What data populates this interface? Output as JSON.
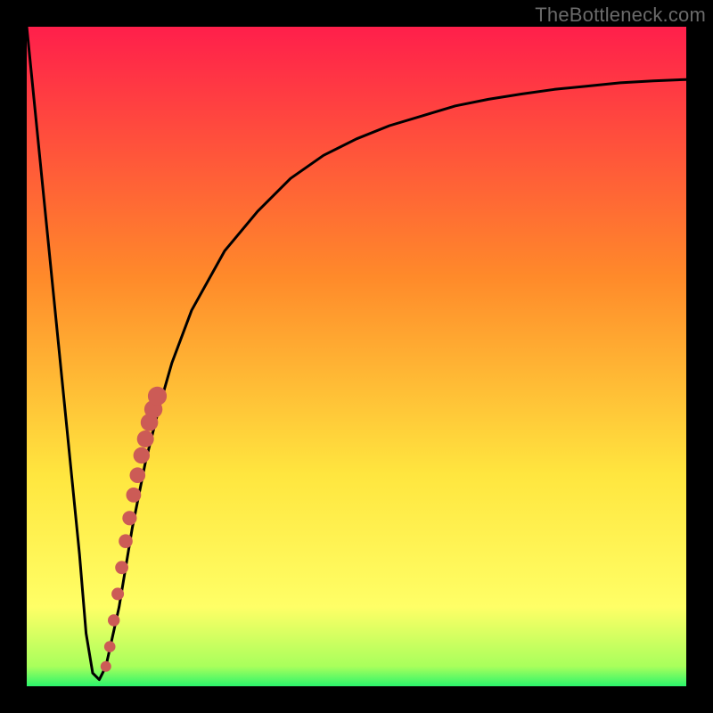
{
  "watermark": "TheBottleneck.com",
  "colors": {
    "gradient_top": "#ff1f4b",
    "gradient_mid1": "#ff8a2a",
    "gradient_mid2": "#ffe63f",
    "gradient_bottom_yellow": "#ffff66",
    "gradient_green": "#2bf56b",
    "curve": "#000000",
    "marker": "#cc5b56",
    "frame_bg": "#000000"
  },
  "chart_data": {
    "type": "line",
    "title": "",
    "xlabel": "",
    "ylabel": "",
    "xlim": [
      0,
      100
    ],
    "ylim": [
      0,
      100
    ],
    "series": [
      {
        "name": "bottleneck-curve",
        "x": [
          0,
          2,
          4,
          6,
          8,
          9,
          10,
          11,
          12,
          14,
          16,
          18,
          20,
          22,
          25,
          30,
          35,
          40,
          45,
          50,
          55,
          60,
          65,
          70,
          75,
          80,
          85,
          90,
          95,
          100
        ],
        "y": [
          100,
          80,
          60,
          40,
          20,
          8,
          2,
          1,
          3,
          12,
          24,
          34,
          42,
          49,
          57,
          66,
          72,
          77,
          80.5,
          83,
          85,
          86.5,
          88,
          89,
          89.8,
          90.5,
          91,
          91.5,
          91.8,
          92
        ]
      }
    ],
    "markers": {
      "name": "highlight-segment",
      "x": [
        12.0,
        12.6,
        13.2,
        13.8,
        14.4,
        15.0,
        15.6,
        16.2,
        16.8,
        17.4,
        18.0,
        18.6,
        19.2,
        19.8
      ],
      "y": [
        3,
        6,
        10,
        14,
        18,
        22,
        25.5,
        29,
        32,
        35,
        37.5,
        40,
        42,
        44
      ]
    }
  }
}
